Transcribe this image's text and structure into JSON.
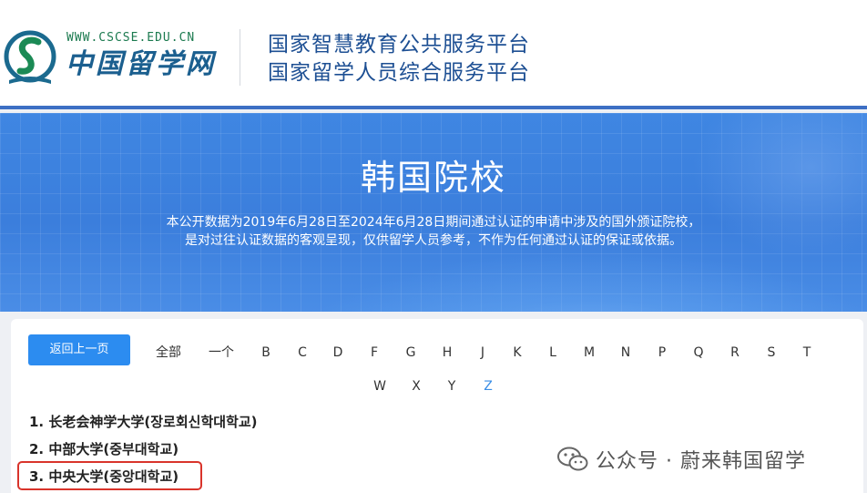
{
  "header": {
    "logo_url": "WWW.CSCSE.EDU.CN",
    "logo_name": "中国留学网",
    "platform_1": "国家智慧教育公共服务平台",
    "platform_2": "国家留学人员综合服务平台"
  },
  "banner": {
    "title": "韩国院校",
    "desc_line_1": "本公开数据为2019年6月28日至2024年6月28日期间通过认证的申请中涉及的国外颁证院校，",
    "desc_line_2": "是对过往认证数据的客观呈现，仅供留学人员参考，不作为任何通过认证的保证或依据。"
  },
  "toolbar": {
    "back_label": "返回上一页"
  },
  "filters": {
    "all": "全部",
    "single": "一个",
    "letters": [
      "B",
      "C",
      "D",
      "F",
      "G",
      "H",
      "J",
      "K",
      "L",
      "M",
      "N",
      "P",
      "Q",
      "R",
      "S",
      "T",
      "W",
      "X",
      "Y",
      "Z"
    ],
    "active": "Z"
  },
  "schools": [
    {
      "index": "1.",
      "name_cn": "长老会神学大学",
      "name_ko": "(장로회신학대학교)"
    },
    {
      "index": "2.",
      "name_cn": "中部大学",
      "name_ko": "(중부대학교)"
    },
    {
      "index": "3.",
      "name_cn": "中央大学",
      "name_ko": "(중앙대학교)"
    }
  ],
  "highlighted_school_index": 3,
  "watermark": {
    "text": "公众号 · 蔚来韩国留学"
  },
  "colors": {
    "brand_blue": "#3d6fc4",
    "banner_blue": "#3b7edc",
    "button_blue": "#2c8cf0",
    "active_filter": "#3a8ee6",
    "highlight_red": "#d9342b",
    "logo_green": "#1b7a4f"
  }
}
